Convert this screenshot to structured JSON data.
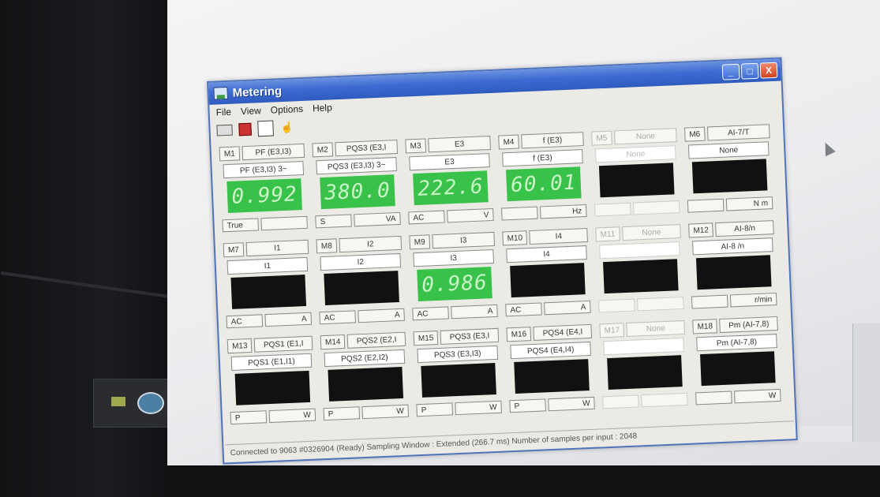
{
  "window": {
    "title": "Metering",
    "controls": {
      "minimize": "_",
      "maximize": "□",
      "close": "X"
    }
  },
  "menu": [
    "File",
    "View",
    "Options",
    "Help"
  ],
  "toolbar": [
    {
      "icon": "print-icon"
    },
    {
      "icon": "red-settings-icon"
    },
    {
      "icon": "copy-icon"
    },
    {
      "icon": "cursor-sequence-icon"
    }
  ],
  "meters": [
    {
      "id": "M1",
      "name": "PF (E3,I3)",
      "sub": "PF (E3,I3) 3~",
      "value": "0.992",
      "lit": true,
      "f1": "True",
      "f2": ""
    },
    {
      "id": "M2",
      "name": "PQS3 (E3,I",
      "sub": "PQS3 (E3,I3) 3~",
      "value": "380.0",
      "lit": true,
      "f1": "S",
      "f2": "VA"
    },
    {
      "id": "M3",
      "name": "E3",
      "sub": "E3",
      "value": "222.6",
      "lit": true,
      "f1": "AC",
      "f2": "V"
    },
    {
      "id": "M4",
      "name": "f (E3)",
      "sub": "f (E3)",
      "value": "60.01",
      "lit": true,
      "f1": "",
      "f2": "Hz"
    },
    {
      "id": "M5",
      "name": "None",
      "sub": "None",
      "value": "",
      "lit": false,
      "f1": "",
      "f2": "",
      "off": true
    },
    {
      "id": "M6",
      "name": "AI-7/T",
      "sub": "None",
      "value": "",
      "lit": false,
      "f1": "",
      "f2": "N m"
    },
    {
      "id": "M7",
      "name": "I1",
      "sub": "I1",
      "value": "",
      "lit": false,
      "f1": "AC",
      "f2": "A"
    },
    {
      "id": "M8",
      "name": "I2",
      "sub": "I2",
      "value": "",
      "lit": false,
      "f1": "AC",
      "f2": "A"
    },
    {
      "id": "M9",
      "name": "I3",
      "sub": "I3",
      "value": "0.986",
      "lit": true,
      "f1": "AC",
      "f2": "A"
    },
    {
      "id": "M10",
      "name": "I4",
      "sub": "I4",
      "value": "",
      "lit": false,
      "f1": "AC",
      "f2": "A"
    },
    {
      "id": "M11",
      "name": "None",
      "sub": "",
      "value": "",
      "lit": false,
      "f1": "",
      "f2": "",
      "off": true
    },
    {
      "id": "M12",
      "name": "AI-8/n",
      "sub": "AI-8 /n",
      "value": "",
      "lit": false,
      "f1": "",
      "f2": "r/min"
    },
    {
      "id": "M13",
      "name": "PQS1 (E1,I",
      "sub": "PQS1 (E1,I1)",
      "value": "",
      "lit": false,
      "f1": "P",
      "f2": "W"
    },
    {
      "id": "M14",
      "name": "PQS2 (E2,I",
      "sub": "PQS2 (E2,I2)",
      "value": "",
      "lit": false,
      "f1": "P",
      "f2": "W"
    },
    {
      "id": "M15",
      "name": "PQS3 (E3,I",
      "sub": "PQS3 (E3,I3)",
      "value": "",
      "lit": false,
      "f1": "P",
      "f2": "W"
    },
    {
      "id": "M16",
      "name": "PQS4 (E4,I",
      "sub": "PQS4 (E4,I4)",
      "value": "",
      "lit": false,
      "f1": "P",
      "f2": "W"
    },
    {
      "id": "M17",
      "name": "None",
      "sub": "",
      "value": "",
      "lit": false,
      "f1": "",
      "f2": "",
      "off": true
    },
    {
      "id": "M18",
      "name": "Pm (AI-7,8)",
      "sub": "Pm (AI-7,8)",
      "value": "",
      "lit": false,
      "f1": "",
      "f2": "W"
    }
  ],
  "status": "Connected to 9063 #0326904 (Ready)  Sampling Window : Extended (266.7 ms)  Number of samples per input : 2048"
}
